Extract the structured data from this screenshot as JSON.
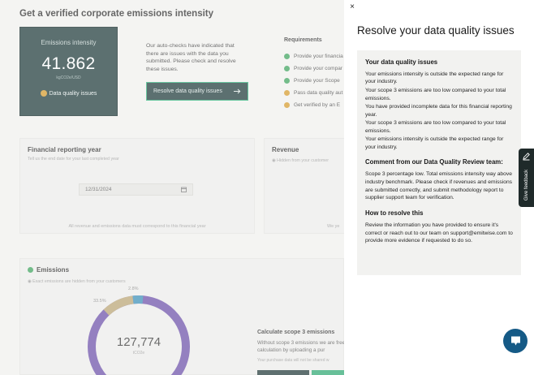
{
  "page": {
    "title": "Get a verified corporate emissions intensity",
    "intensity_card": {
      "label": "Emissions intensity",
      "value": "41.862",
      "unit": "kgCO2e/USD",
      "status": "Data quality issues",
      "status_icon": "warning-dot-icon"
    },
    "autocheck_text": "Our auto-checks have indicated that there are issues with the data you submitted. Please check and resolve these issues.",
    "resolve_button": {
      "label": "Resolve data quality issues",
      "icon": "arrow-right-icon"
    },
    "requirements": {
      "title": "Requirements",
      "items": [
        {
          "label": "Provide your financia",
          "status": "done"
        },
        {
          "label": "Provide your compar",
          "status": "done"
        },
        {
          "label": "Provide your Scope",
          "status": "done"
        },
        {
          "label": "Pass data quality aut",
          "status": "warning"
        },
        {
          "label": "Get verified by an E",
          "status": "warning"
        }
      ]
    },
    "financial_year": {
      "title": "Financial reporting year",
      "subtitle": "Tell us the end date for your last completed year",
      "date_value": "12/31/2024",
      "note": "All revenue and emissions data must correspond to this financial year"
    },
    "revenue": {
      "title": "Revenue",
      "subtitle": "Hidden from your customer",
      "note": "We ye"
    },
    "emissions": {
      "title": "Emissions",
      "subtitle": "Exact emissions are hidden from your customers",
      "total": "127,774",
      "unit": "tCO2e",
      "pct_small": "2.8%",
      "pct_mid": "33.5%",
      "calc_title": "Calculate scope 3 emissions",
      "calc_text": "Without scope 3 emissions we are free calculation by uploading a pur",
      "calc_note": "Your purchase data will not be shared w"
    }
  },
  "drawer": {
    "title": "Resolve your data quality issues",
    "close_label": "×",
    "issues_heading": "Your data quality issues",
    "issues": [
      "Your emissions intensity is outside the expected range for your industry.",
      "Your scope 3 emissions are too low compared to your total emissions.",
      "You have provided incomplete data for this financial reporting year.",
      "Your scope 3 emissions are too low compared to your total emissions.",
      "Your emissions intensity is outside the expected range for your industry."
    ],
    "comment_heading": "Comment from our Data Quality Review team:",
    "comment_text": "Scope 3 percentage low. Total emissions intensity way above industry benchmark. Please check if revenues and emissions are submitted correctly, and submit methodology report to supplier support team for verification.",
    "how_heading": "How to resolve this",
    "how_text": "Review the information you have provided to ensure it's correct or reach out to our team on support@emitwise.com to provide more evidence if requested to do so."
  },
  "feedback_tab": {
    "label": "Give feedback",
    "icon": "pencil-icon"
  },
  "chat": {
    "icon": "chat-bubble-icon"
  },
  "colors": {
    "accent_green": "#2fb07a",
    "dark_teal": "#1e3a3a",
    "warning": "#d49a2c",
    "chat_blue": "#155a86"
  }
}
